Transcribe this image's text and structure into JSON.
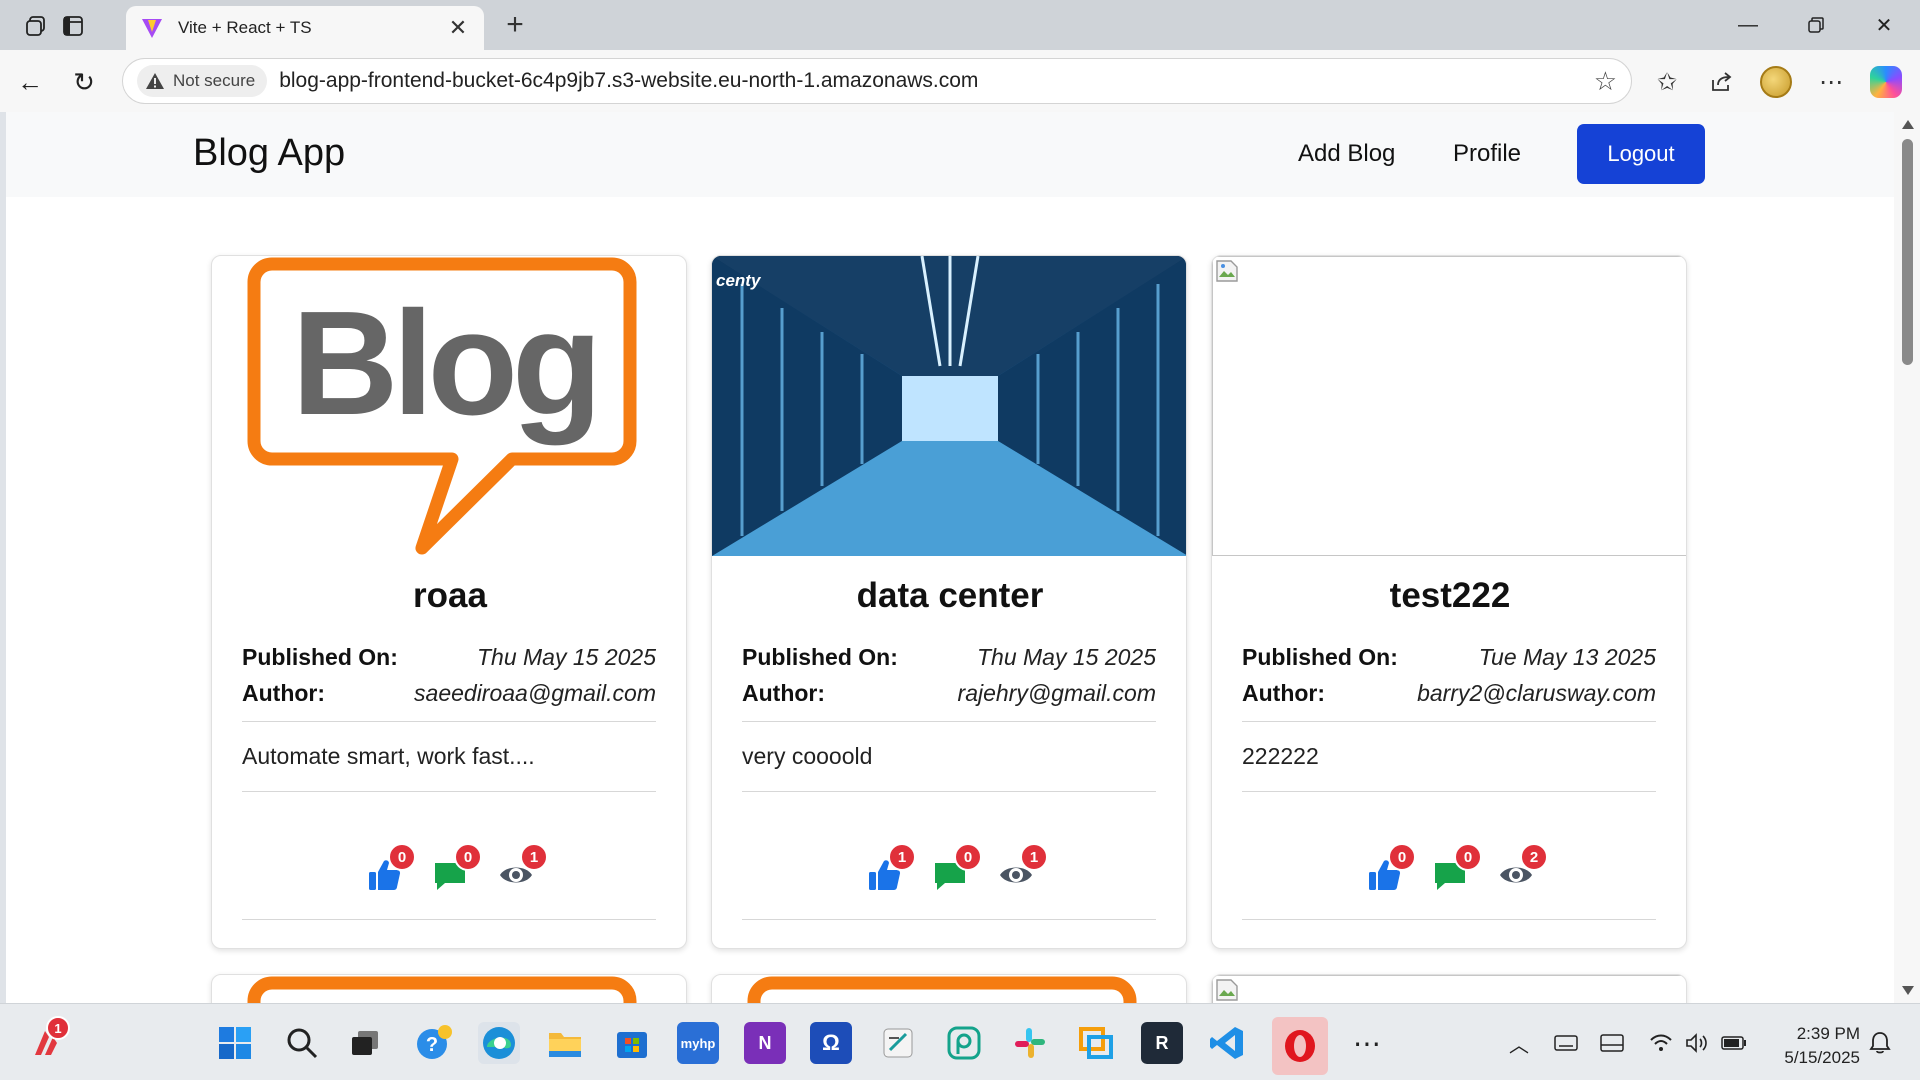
{
  "browser": {
    "tab_title": "Vite + React + TS",
    "security_label": "Not secure",
    "url": "blog-app-frontend-bucket-6c4p9jb7.s3-website.eu-north-1.amazonaws.com"
  },
  "header": {
    "brand": "Blog App",
    "nav": {
      "add_blog": "Add Blog",
      "profile": "Profile",
      "logout": "Logout"
    }
  },
  "labels": {
    "published_on": "Published On:",
    "author": "Author:"
  },
  "blogs": [
    {
      "title": "roaa",
      "published": "Thu May 15 2025",
      "author": "saeediroaa@gmail.com",
      "content": "Automate smart, work fast....",
      "image": "blog-logo",
      "likes": "0",
      "comments": "0",
      "views": "1"
    },
    {
      "title": "data center",
      "published": "Thu May 15 2025",
      "author": "rajehry@gmail.com",
      "content": "very coooold",
      "image": "data-center-photo",
      "image_watermark": "centy",
      "likes": "1",
      "comments": "0",
      "views": "1"
    },
    {
      "title": "test222",
      "published": "Tue May 13 2025",
      "author": "barry2@clarusway.com",
      "content": "222222",
      "image": "broken-image",
      "likes": "0",
      "comments": "0",
      "views": "2"
    }
  ],
  "taskbar": {
    "notification_count": "1",
    "time": "2:39 PM",
    "date": "5/15/2025",
    "apps": [
      "windows-start",
      "search",
      "task-view",
      "help",
      "edge",
      "file-explorer",
      "microsoft-store",
      "myhp",
      "onenote",
      "qt",
      "notes",
      "picsart",
      "slack",
      "vmware",
      "rstudio",
      "vscode",
      "opera",
      "more"
    ]
  },
  "colors": {
    "primary": "#1542d6",
    "badge": "#e0303a",
    "like": "#1a73e8",
    "comment": "#16a34a",
    "view": "#4b5563",
    "blog_orange": "#f57c12",
    "blog_gray": "#666666"
  }
}
